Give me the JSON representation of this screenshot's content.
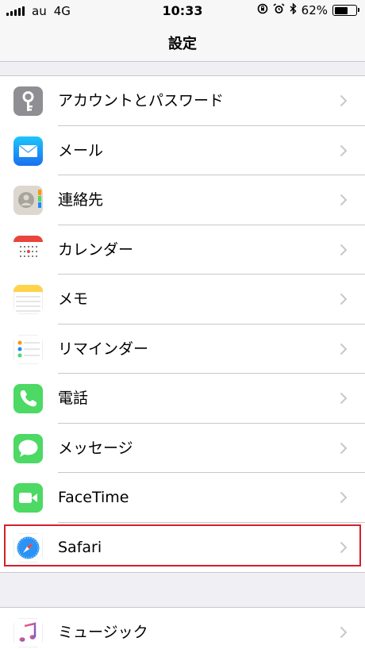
{
  "status": {
    "carrier": "au",
    "network": "4G",
    "time": "10:33",
    "battery": "62%",
    "battery_level": 0.62
  },
  "nav": {
    "title": "設定"
  },
  "rows": [
    {
      "label": "アカウントとパスワード",
      "icon": "key-icon",
      "color": "#8e8e93"
    },
    {
      "label": "メール",
      "icon": "mail-icon",
      "color": "#1a8cf5"
    },
    {
      "label": "連絡先",
      "icon": "contacts-icon",
      "color": "#d8d4cc"
    },
    {
      "label": "カレンダー",
      "icon": "calendar-icon",
      "color": "#ffffff"
    },
    {
      "label": "メモ",
      "icon": "notes-icon",
      "color": "#ffffff"
    },
    {
      "label": "リマインダー",
      "icon": "reminders-icon",
      "color": "#ffffff"
    },
    {
      "label": "電話",
      "icon": "phone-icon",
      "color": "#4cd964"
    },
    {
      "label": "メッセージ",
      "icon": "messages-icon",
      "color": "#4cd964"
    },
    {
      "label": "FaceTime",
      "icon": "facetime-icon",
      "color": "#4cd964"
    },
    {
      "label": "Safari",
      "icon": "safari-icon",
      "color": "#ffffff"
    }
  ],
  "rows2": [
    {
      "label": "ミュージック",
      "icon": "music-icon",
      "color": "#ffffff"
    }
  ],
  "colors": {
    "highlight": "#d61f2c",
    "separator": "#c8c7cc",
    "chevron": "#c7c7cc"
  }
}
